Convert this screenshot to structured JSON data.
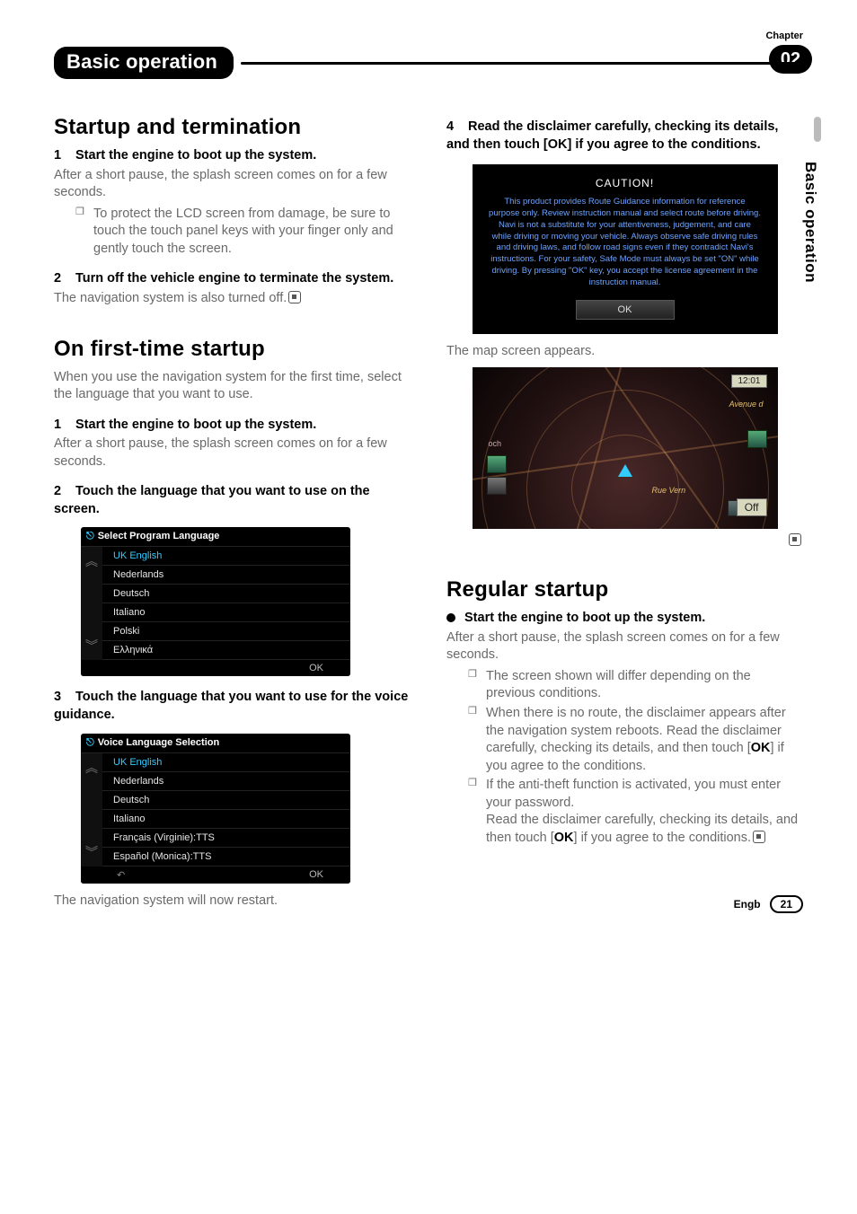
{
  "chapter_label": "Chapter",
  "chapter_number": "02",
  "header_title": "Basic operation",
  "side_label": "Basic operation",
  "left": {
    "section1_title": "Startup and termination",
    "step1": {
      "num": "1",
      "text": "Start the engine to boot up the system."
    },
    "step1_body": "After a short pause, the splash screen comes on for a few seconds.",
    "step1_note": "To protect the LCD screen from damage, be sure to touch the touch panel keys with your finger only and gently touch the screen.",
    "step2": {
      "num": "2",
      "text": "Turn off the vehicle engine to terminate the system."
    },
    "step2_body": "The navigation system is also turned off.",
    "section2_title": "On first-time startup",
    "section2_intro": "When you use the navigation system for the first time, select the language that you want to use.",
    "s2_step1": {
      "num": "1",
      "text": "Start the engine to boot up the system."
    },
    "s2_step1_body": "After a short pause, the splash screen comes on for a few seconds.",
    "s2_step2": {
      "num": "2",
      "text": "Touch the language that you want to use on the screen."
    },
    "lang_fig": {
      "title": "Select Program Language",
      "items": [
        "UK English",
        "Nederlands",
        "Deutsch",
        "Italiano",
        "Polski",
        "Ελληνικά"
      ],
      "footer_ok": "OK",
      "arrow_up": "︽",
      "arrow_down": "︾"
    },
    "s2_step3": {
      "num": "3",
      "text": "Touch the language that you want to use for the voice guidance."
    },
    "voice_fig": {
      "title": "Voice Language Selection",
      "items": [
        "UK English",
        "Nederlands",
        "Deutsch",
        "Italiano",
        "Français (Virginie):TTS",
        "Español (Monica):TTS"
      ],
      "footer_ok": "OK",
      "footer_back": "↶",
      "arrow_up": "︽",
      "arrow_down": "︾"
    },
    "s2_after": "The navigation system will now restart."
  },
  "right": {
    "step4": {
      "num": "4",
      "text": "Read the disclaimer carefully, checking its details, and then touch [OK] if you agree to the conditions."
    },
    "caution": {
      "title": "CAUTION!",
      "body": "This product provides Route Guidance information for reference purpose only. Review instruction manual and select route before driving. Navi is not a substitute for your attentiveness, judgement, and care while driving or moving your vehicle. Always observe safe driving rules and driving laws, and follow road signs even if they contradict Navi's instructions. For your safety, Safe Mode must always be set \"ON\" while driving. By pressing \"OK\" key, you accept the license agreement in the instruction manual.",
      "ok": "OK"
    },
    "map_caption": "The map screen appears.",
    "map": {
      "time": "12:01",
      "off": "Off",
      "street1": "Avenue d",
      "street2": "Rue Vern",
      "small": "och"
    },
    "section3_title": "Regular startup",
    "s3_bullet": "Start the engine to boot up the system.",
    "s3_body": "After a short pause, the splash screen comes on for a few seconds.",
    "s3_note1": "The screen shown will differ depending on the previous conditions.",
    "s3_note2a": "When there is no route, the disclaimer appears after the navigation system reboots. Read the disclaimer carefully, checking its details, and then touch [",
    "s3_note2_ok": "OK",
    "s3_note2b": "] if you agree to the conditions.",
    "s3_note3a": "If the anti-theft function is activated, you must enter your password.",
    "s3_note3b": "Read the disclaimer carefully, checking its details, and then touch [",
    "s3_note3_ok": "OK",
    "s3_note3c": "] if you agree to the conditions."
  },
  "footer": {
    "lang": "Engb",
    "page": "21"
  }
}
